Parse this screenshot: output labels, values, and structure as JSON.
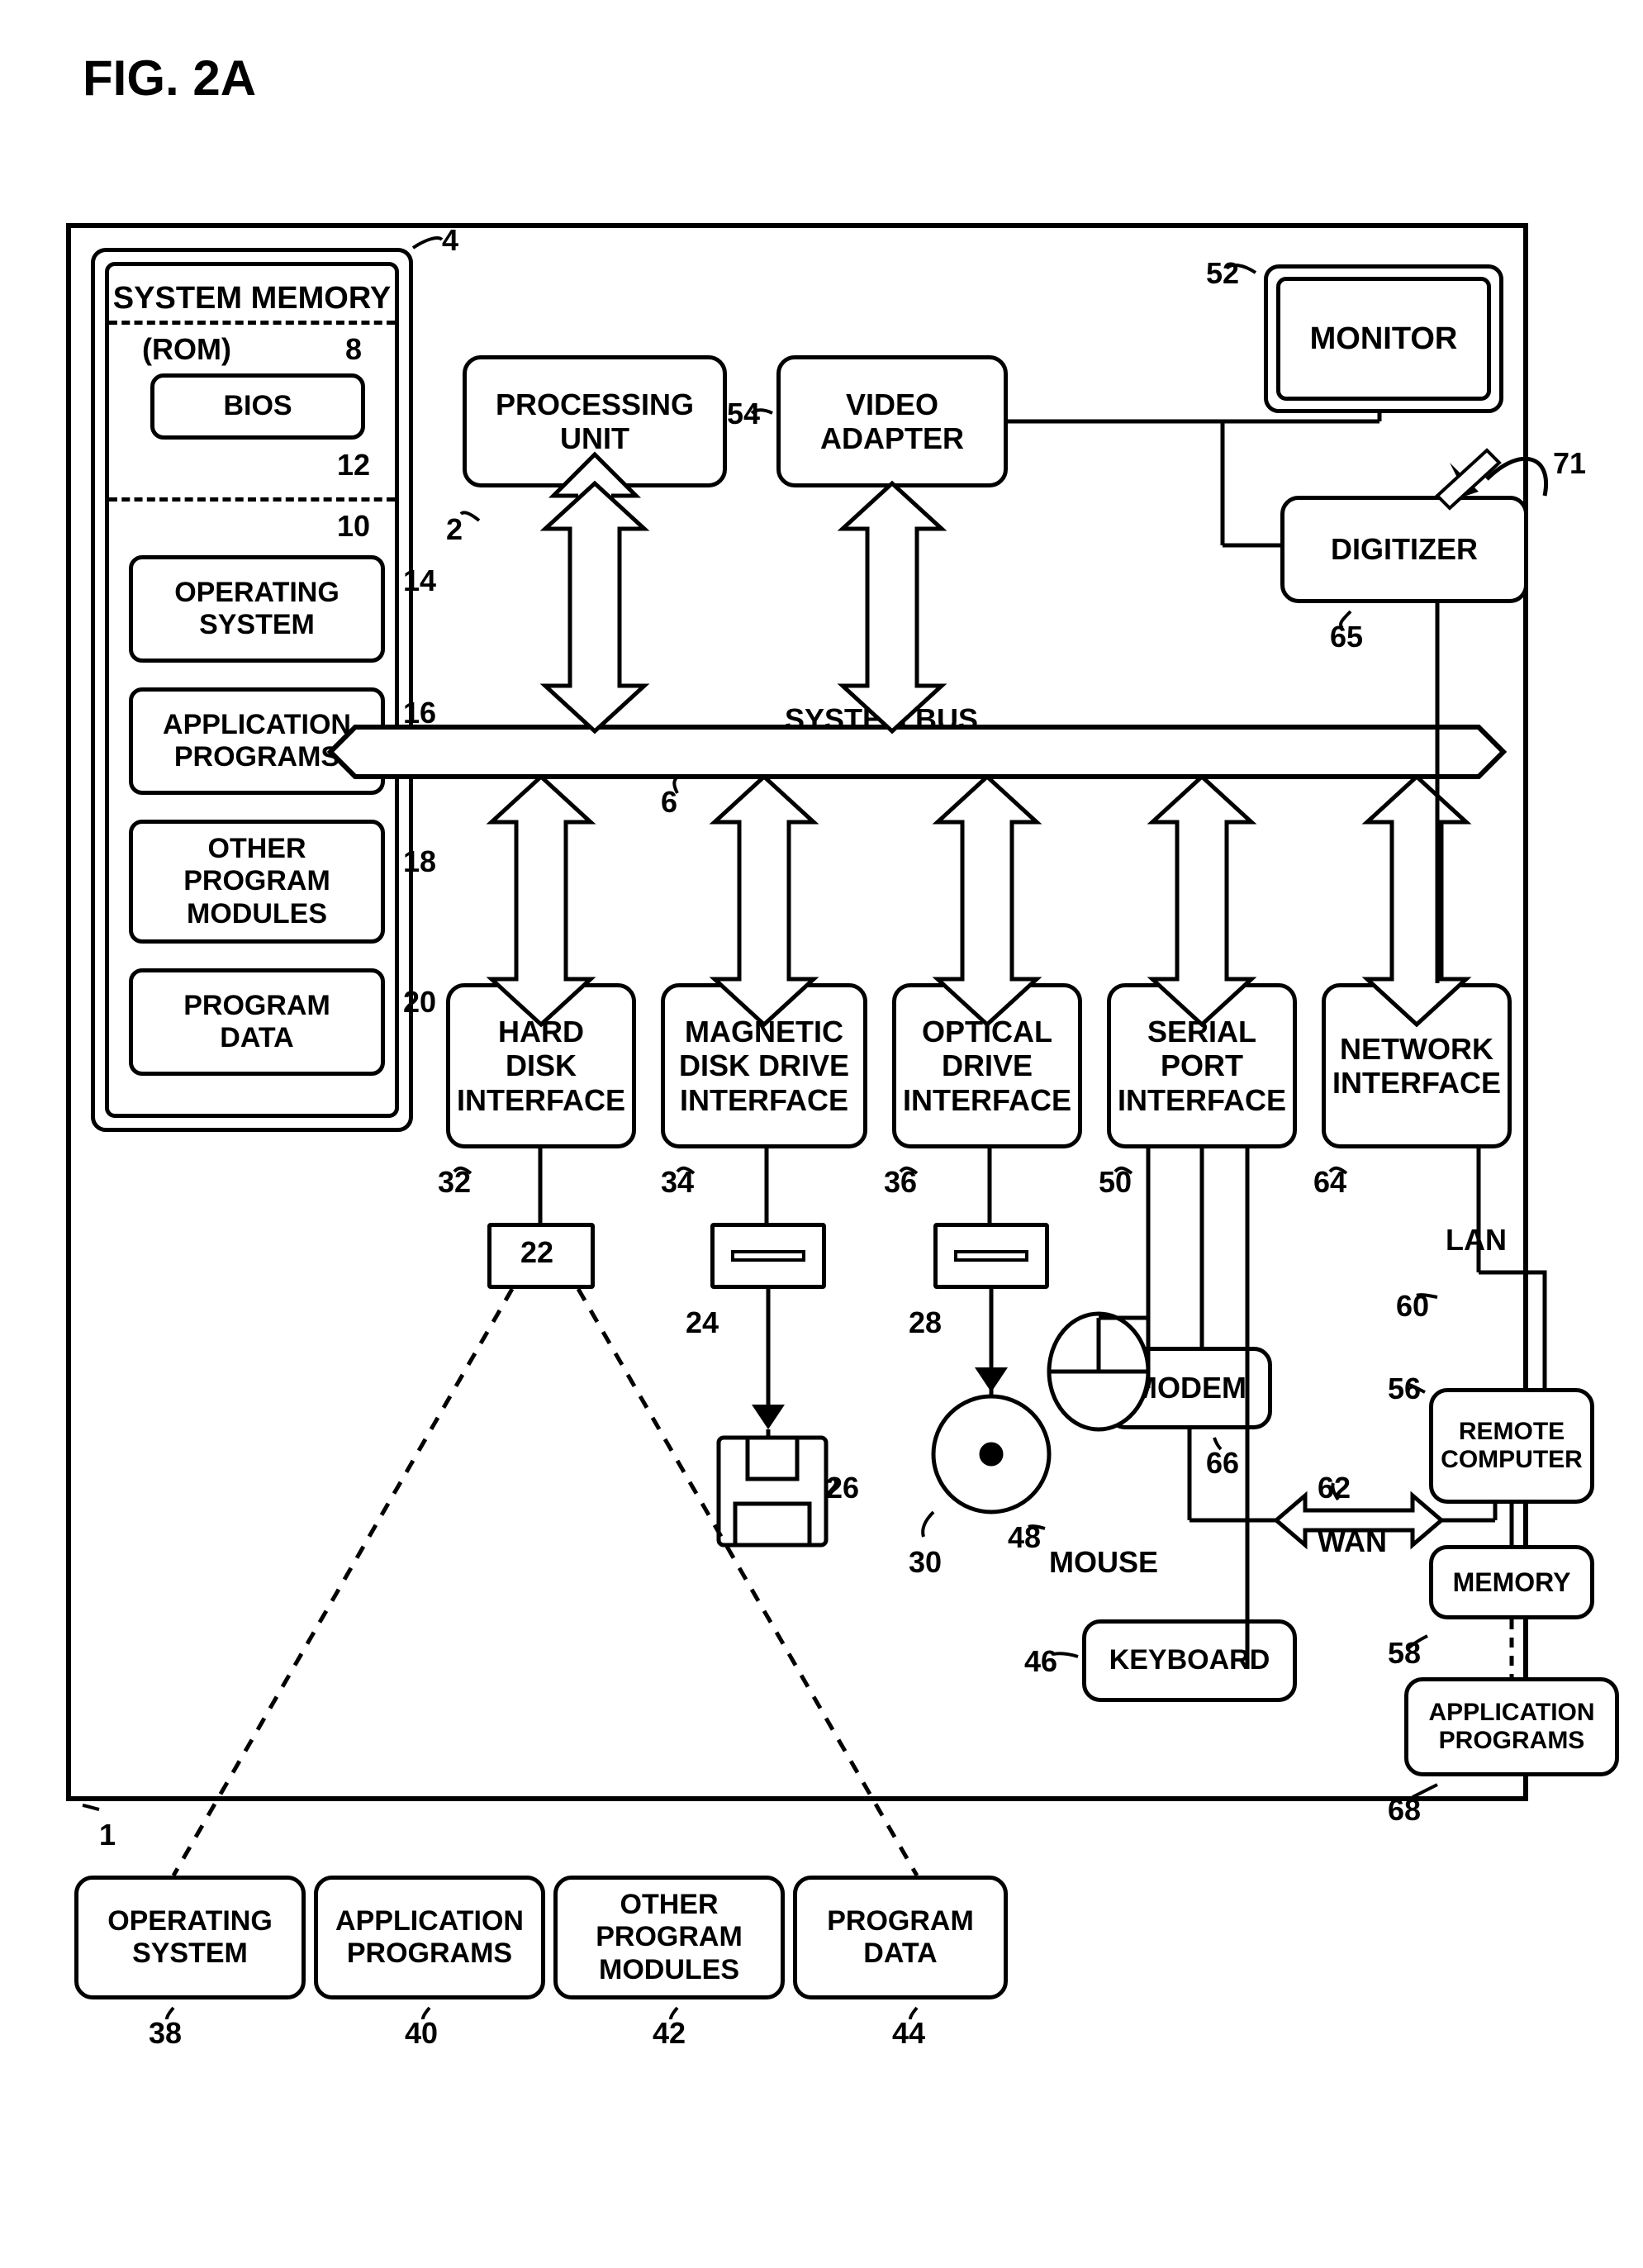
{
  "figure": "FIG. 2A",
  "system_bus": "SYSTEM BUS",
  "sysmem": {
    "title": "SYSTEM MEMORY",
    "rom": "(ROM)",
    "bios": "BIOS",
    "os": "OPERATING\nSYSTEM",
    "apps": "APPLICATION\nPROGRAMS",
    "mods": "OTHER\nPROGRAM\nMODULES",
    "data": "PROGRAM\nDATA"
  },
  "blocks": {
    "processing_unit": "PROCESSING\nUNIT",
    "video_adapter": "VIDEO\nADAPTER",
    "hard_disk_if": "HARD\nDISK\nINTERFACE",
    "mag_disk_if": "MAGNETIC\nDISK DRIVE\nINTERFACE",
    "optical_if": "OPTICAL\nDRIVE\nINTERFACE",
    "serial_if": "SERIAL\nPORT\nINTERFACE",
    "network_if": "NETWORK\nINTERFACE",
    "monitor": "MONITOR",
    "digitizer": "DIGITIZER",
    "remote": "REMOTE\nCOMPUTER",
    "memory": "MEMORY",
    "remote_apps": "APPLICATION\nPROGRAMS",
    "modem": "MODEM",
    "keyboard": "KEYBOARD",
    "mouse": "MOUSE",
    "lan": "LAN",
    "wan": "WAN"
  },
  "bottom_row": {
    "os": "OPERATING\nSYSTEM",
    "apps": "APPLICATION\nPROGRAMS",
    "mods": "OTHER\nPROGRAM\nMODULES",
    "data": "PROGRAM\nDATA"
  },
  "nums": {
    "sysmem": "4",
    "rom": "8",
    "bios": "12",
    "ram_region": "10",
    "os": "14",
    "apps": "16",
    "mods": "18",
    "data": "20",
    "processing": "2",
    "video_adapter": "54",
    "monitor": "52",
    "sysbus": "6",
    "hard_disk_if": "32",
    "mag_disk_if": "34",
    "optical_if": "36",
    "serial_if": "50",
    "network_if": "64",
    "hard_disk": "22",
    "mag_media": "24",
    "mag_disk": "26",
    "optical_drive": "28",
    "optical_disc": "30",
    "mouse": "48",
    "keyboard": "46",
    "modem": "66",
    "wan": "62",
    "lan": "60",
    "remote": "56",
    "memory_remote": "58",
    "remote_apps": "68",
    "digitizer": "65",
    "pen": "71",
    "computer": "1",
    "b_os": "38",
    "b_apps": "40",
    "b_mods": "42",
    "b_data": "44"
  }
}
